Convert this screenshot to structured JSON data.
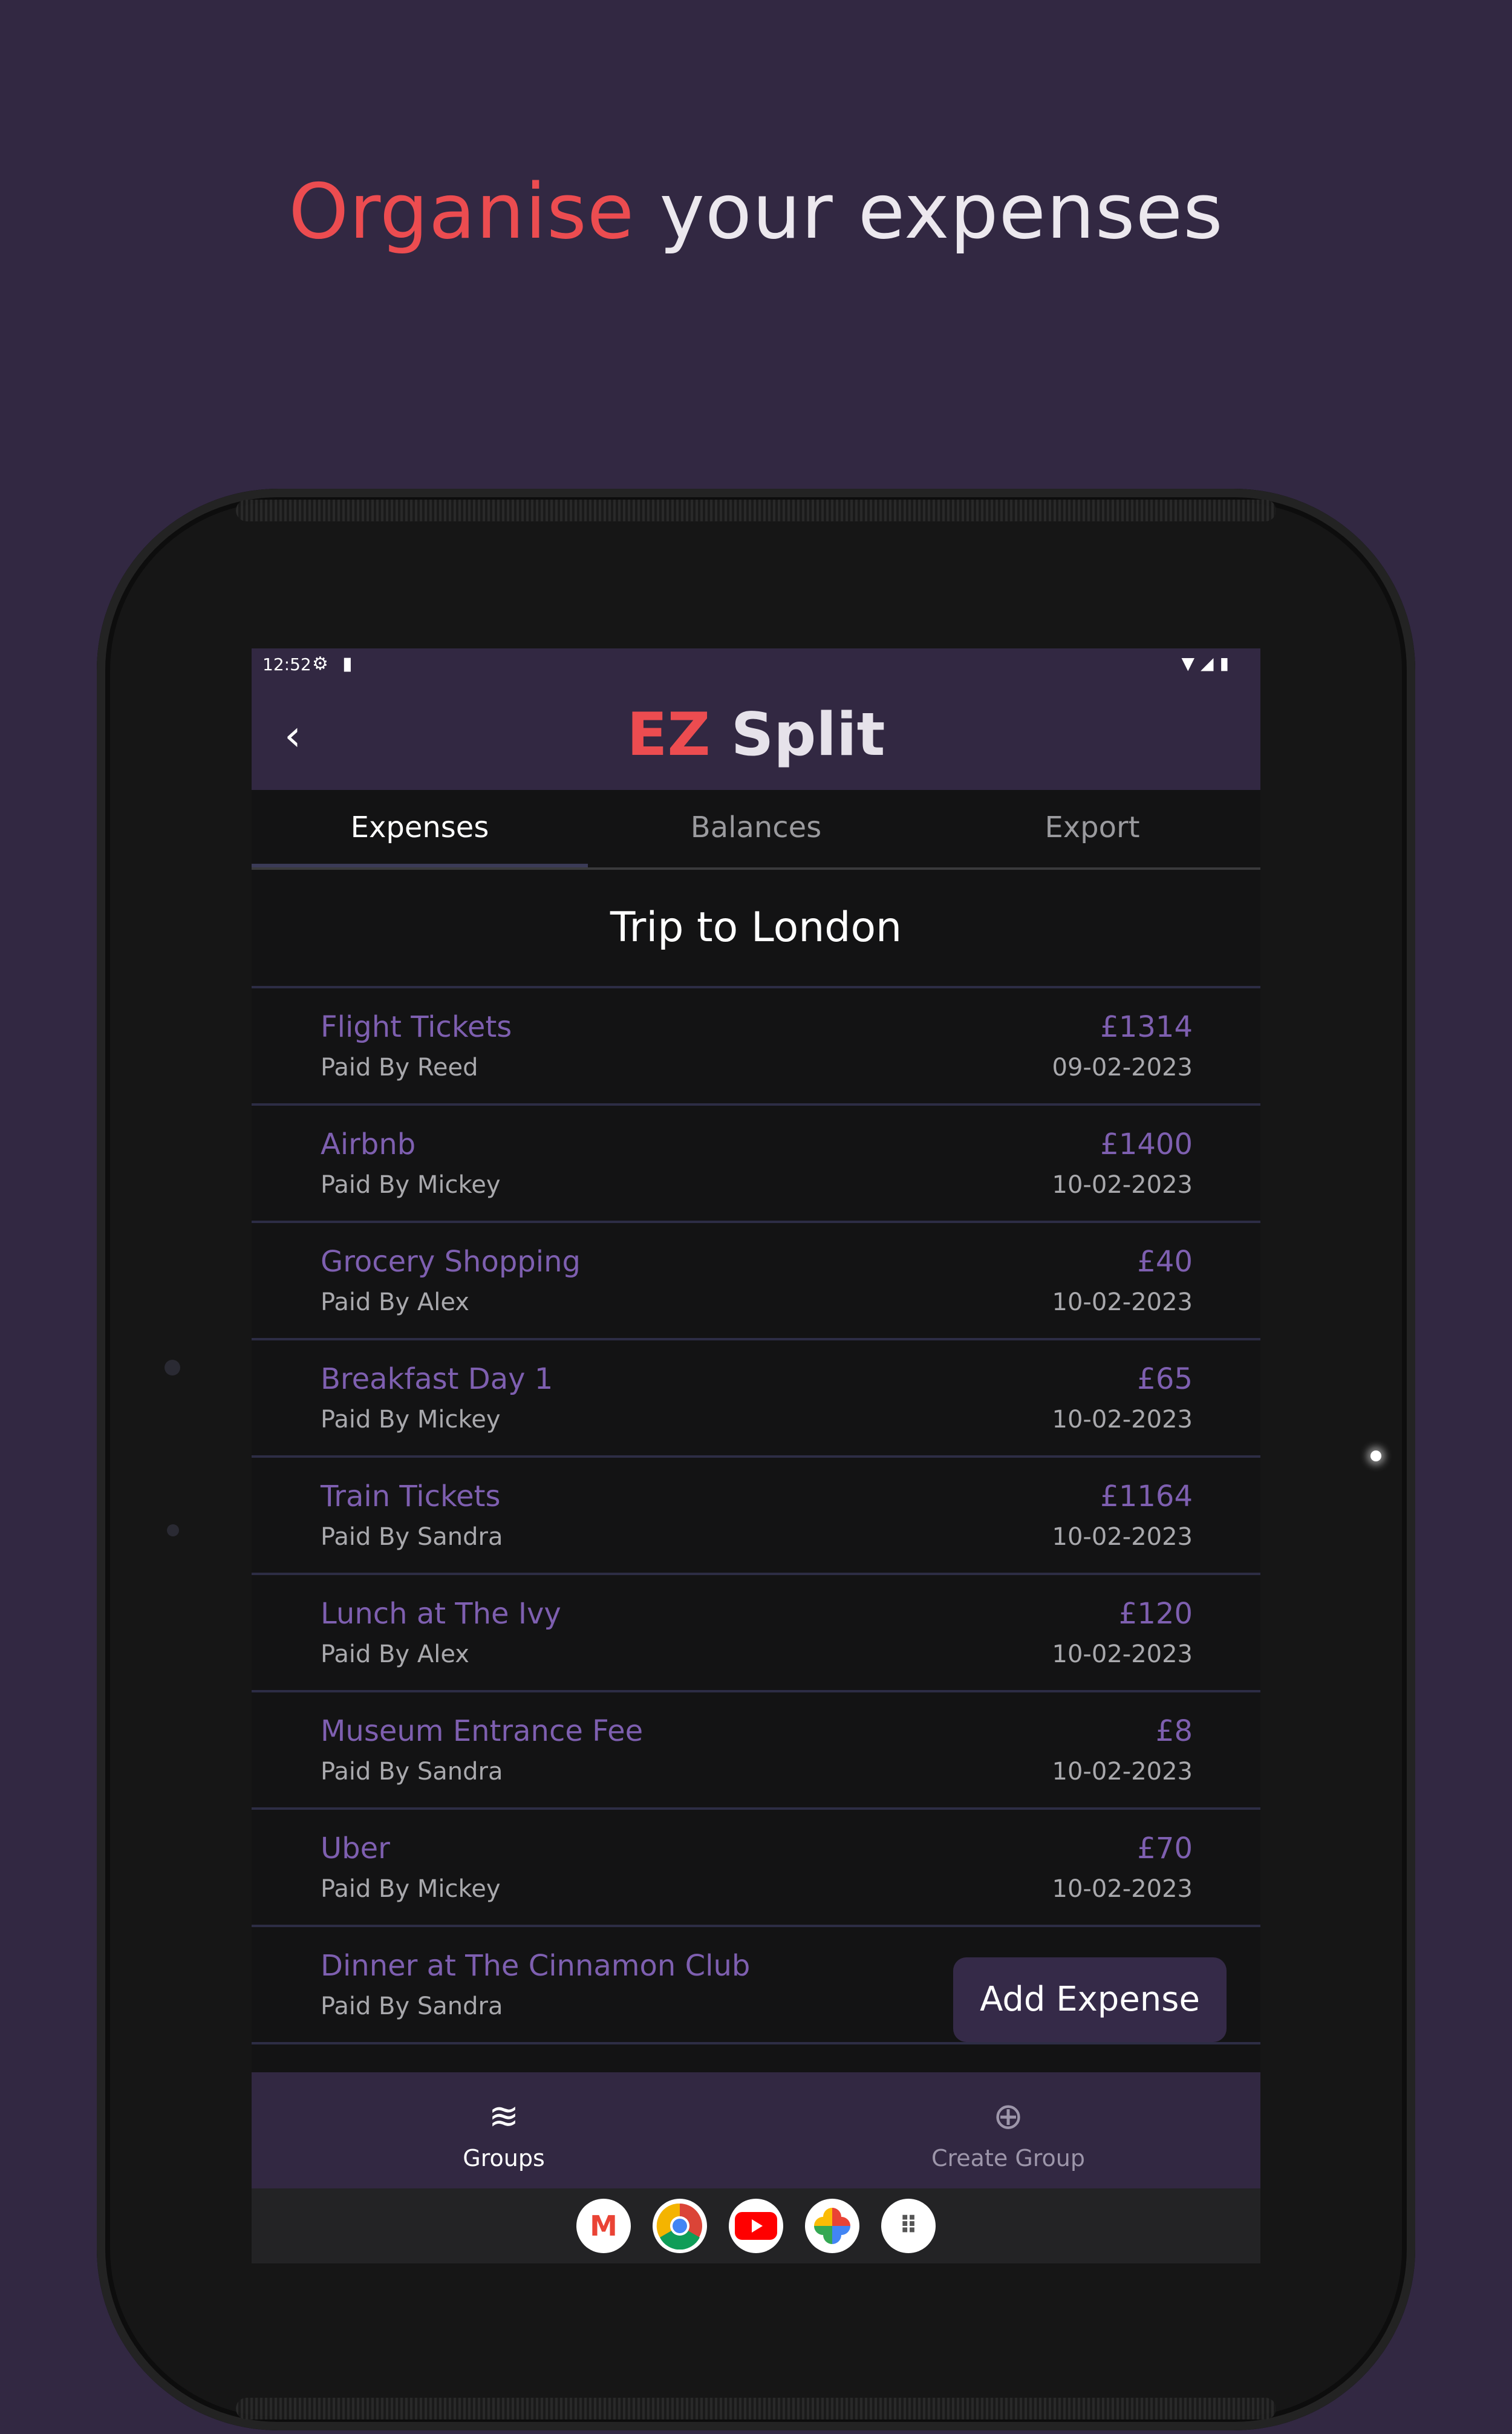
{
  "headline": {
    "accent": "Organise",
    "rest": "your expenses"
  },
  "status_bar": {
    "time": "12:52"
  },
  "app_bar": {
    "title_accent": "EZ",
    "title_rest": "Split"
  },
  "tabs": [
    {
      "label": "Expenses",
      "active": true
    },
    {
      "label": "Balances",
      "active": false
    },
    {
      "label": "Export",
      "active": false
    }
  ],
  "group_title": "Trip to London",
  "expenses": [
    {
      "name": "Flight Tickets",
      "payer": "Paid By Reed",
      "amount": "£1314",
      "date": "09-02-2023"
    },
    {
      "name": "Airbnb",
      "payer": "Paid By Mickey",
      "amount": "£1400",
      "date": "10-02-2023"
    },
    {
      "name": "Grocery Shopping",
      "payer": "Paid By Alex",
      "amount": "£40",
      "date": "10-02-2023"
    },
    {
      "name": "Breakfast Day 1",
      "payer": "Paid By Mickey",
      "amount": "£65",
      "date": "10-02-2023"
    },
    {
      "name": "Train Tickets",
      "payer": "Paid By Sandra",
      "amount": "£1164",
      "date": "10-02-2023"
    },
    {
      "name": "Lunch at The Ivy",
      "payer": "Paid By Alex",
      "amount": "£120",
      "date": "10-02-2023"
    },
    {
      "name": "Museum Entrance Fee",
      "payer": "Paid By Sandra",
      "amount": "£8",
      "date": "10-02-2023"
    },
    {
      "name": "Uber",
      "payer": "Paid By Mickey",
      "amount": "£70",
      "date": "10-02-2023"
    },
    {
      "name": "Dinner at The Cinnamon Club",
      "payer": "Paid By Sandra",
      "amount": "",
      "date": ""
    }
  ],
  "fab": {
    "label": "Add Expense"
  },
  "bottom_nav": {
    "groups": {
      "label": "Groups",
      "icon": "layers-icon"
    },
    "create_group": {
      "label": "Create Group",
      "icon": "add-circle-icon"
    }
  },
  "dock_apps": [
    "gmail-icon",
    "chrome-icon",
    "youtube-icon",
    "photos-icon",
    "app-drawer-icon"
  ],
  "colors": {
    "background": "#322842",
    "accent_red": "#EC4C50",
    "expense_purple": "#7E5FB0",
    "screen_bg": "#131314"
  }
}
